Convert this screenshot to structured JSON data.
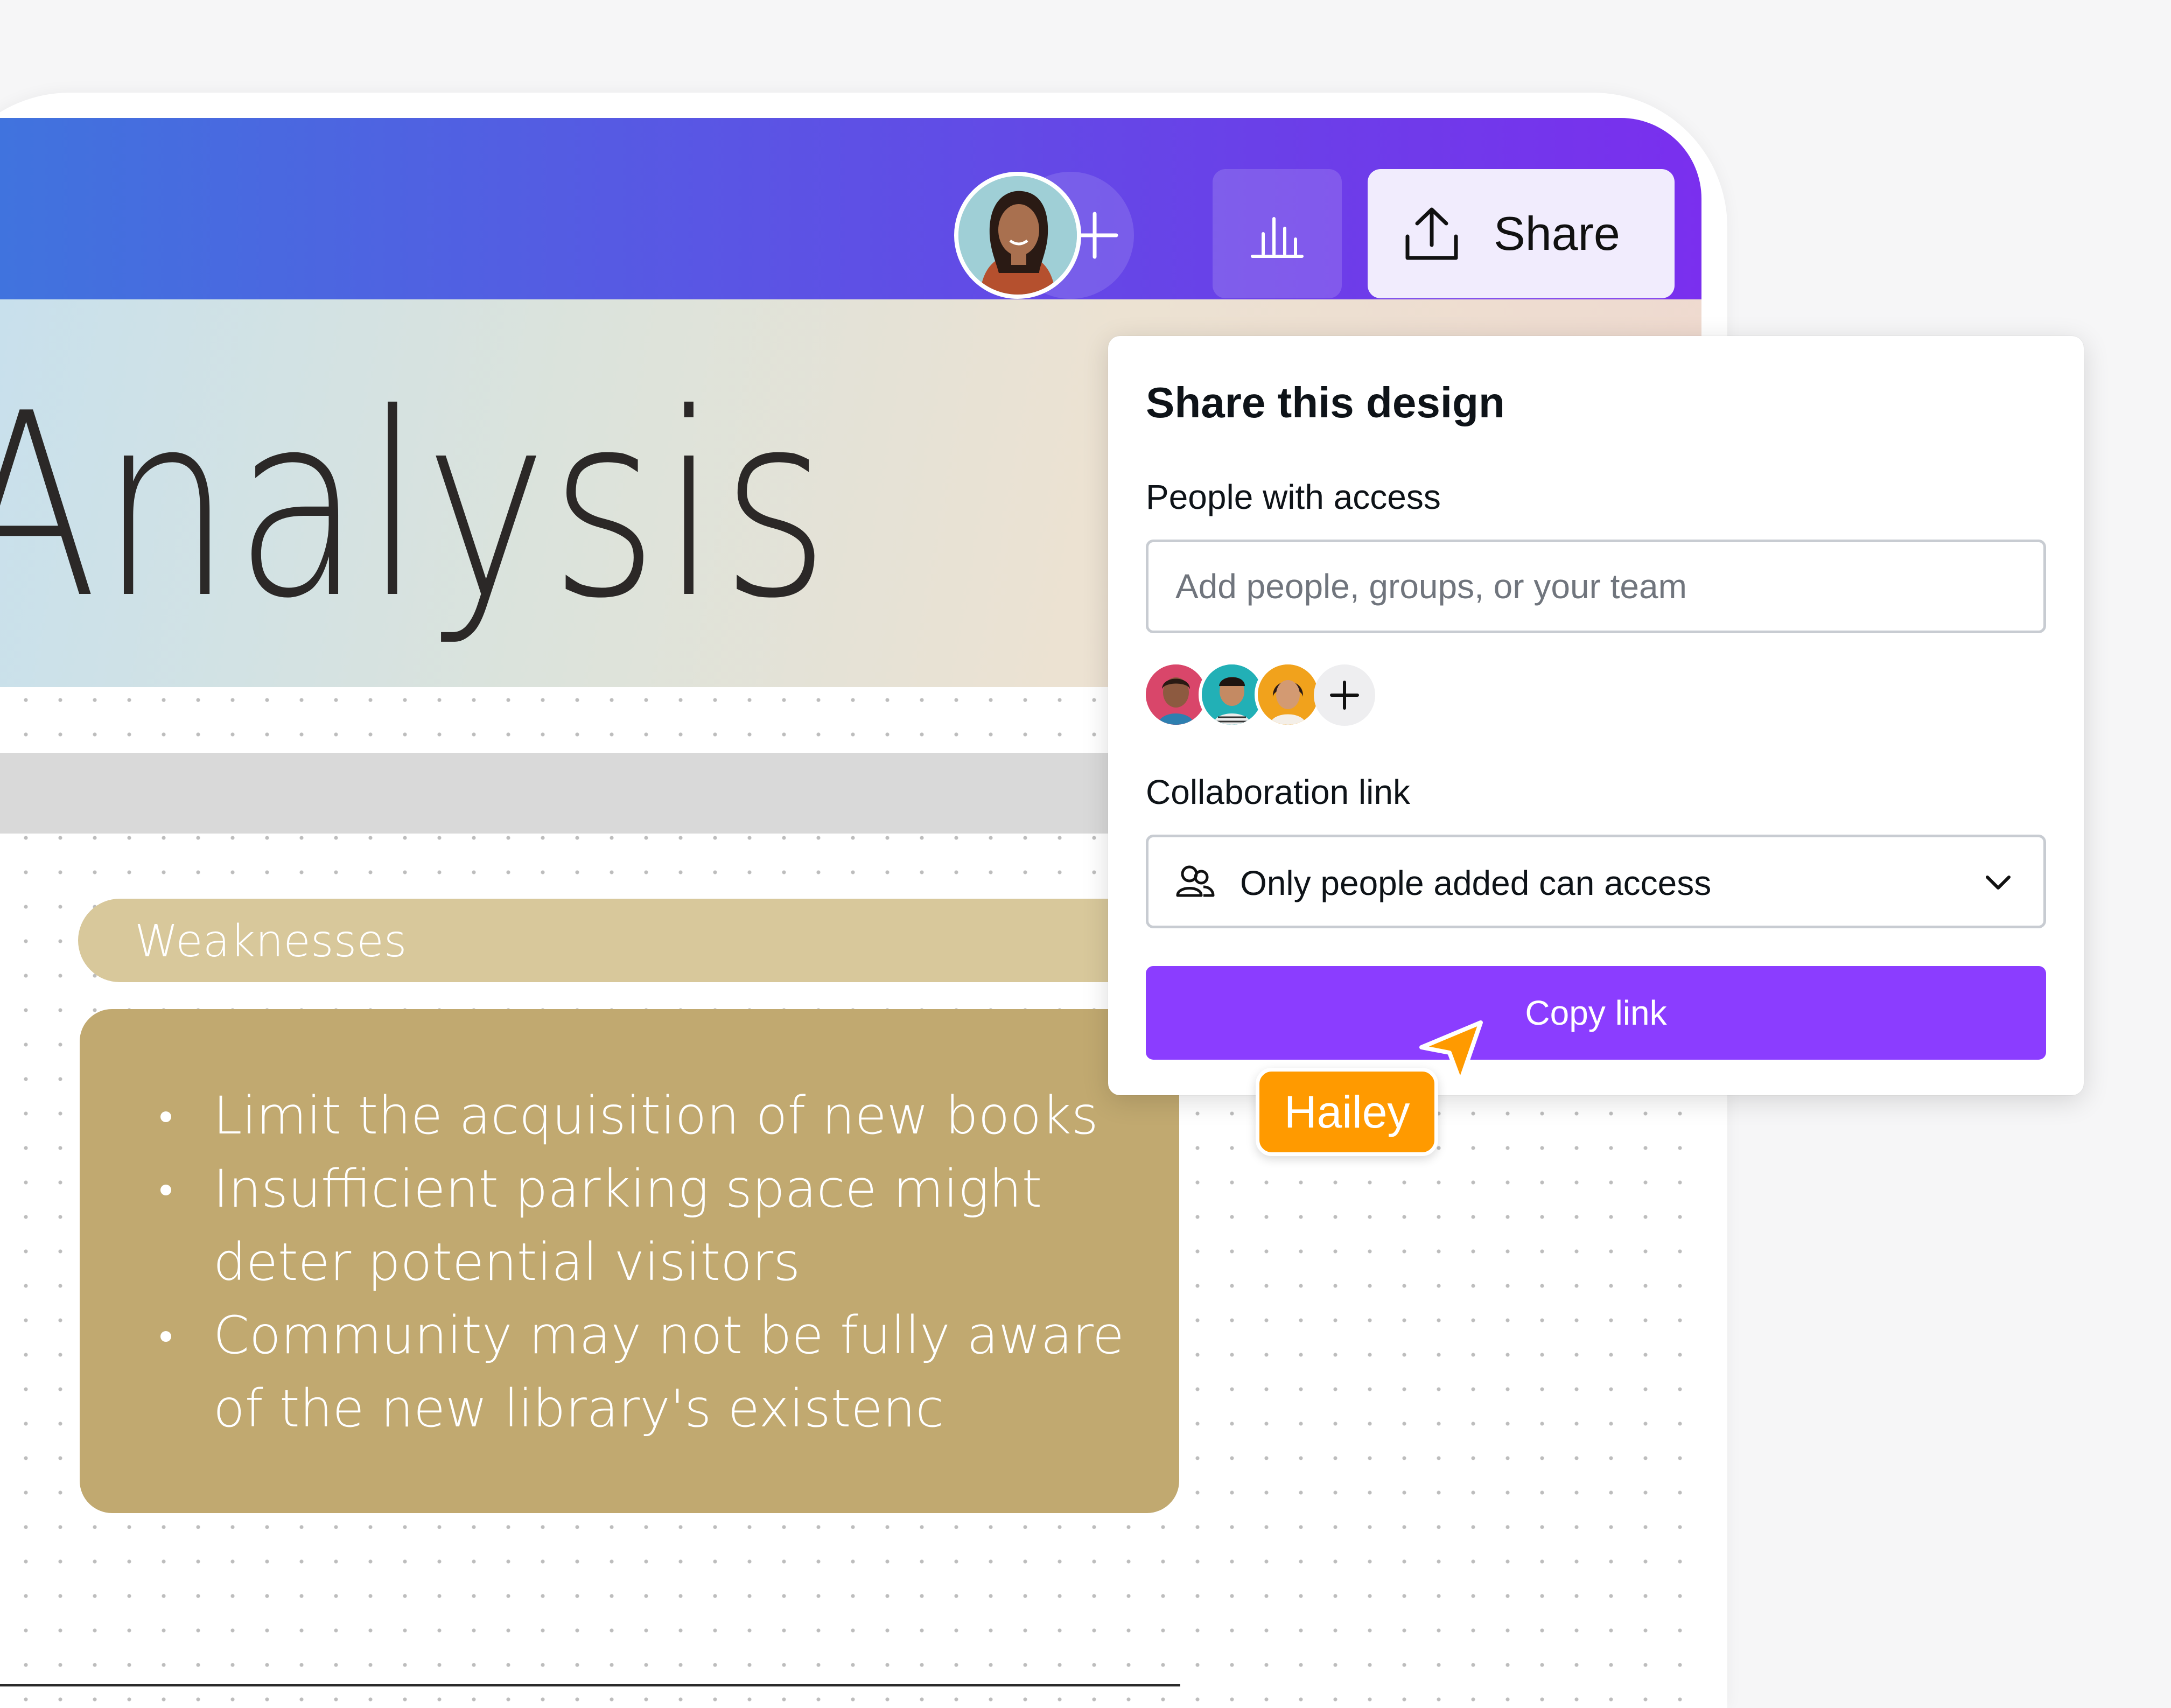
{
  "colors": {
    "topbar_start": "#3e76dd",
    "topbar_end": "#7a2fee",
    "accent": "#8b3dff",
    "weakness_header": "#d8c89b",
    "weakness_card": "#c1a970",
    "cursor": "#ff9a00"
  },
  "toolbar": {
    "avatar_icon": "user-avatar",
    "add_icon": "plus-icon",
    "analytics_icon": "bar-chart-icon",
    "share_icon": "upload-icon",
    "share_label": "Share"
  },
  "canvas": {
    "title": "T Analysis",
    "weaknesses": {
      "header": "Weaknesses",
      "items": [
        "Limit the acquisition of new books",
        "Insufficient parking space might deter potential visitors",
        "Community may not be fully aware of the new library's existenc"
      ]
    }
  },
  "share_panel": {
    "title": "Share this design",
    "people_label": "People with access",
    "people_placeholder": "Add people, groups, or your team",
    "collab_label": "Collaboration link",
    "access_icon": "people-icon",
    "access_value": "Only people added can access",
    "dropdown_icon": "chevron-down-icon",
    "copy_label": "Copy link"
  },
  "cursor": {
    "name": "Hailey"
  }
}
